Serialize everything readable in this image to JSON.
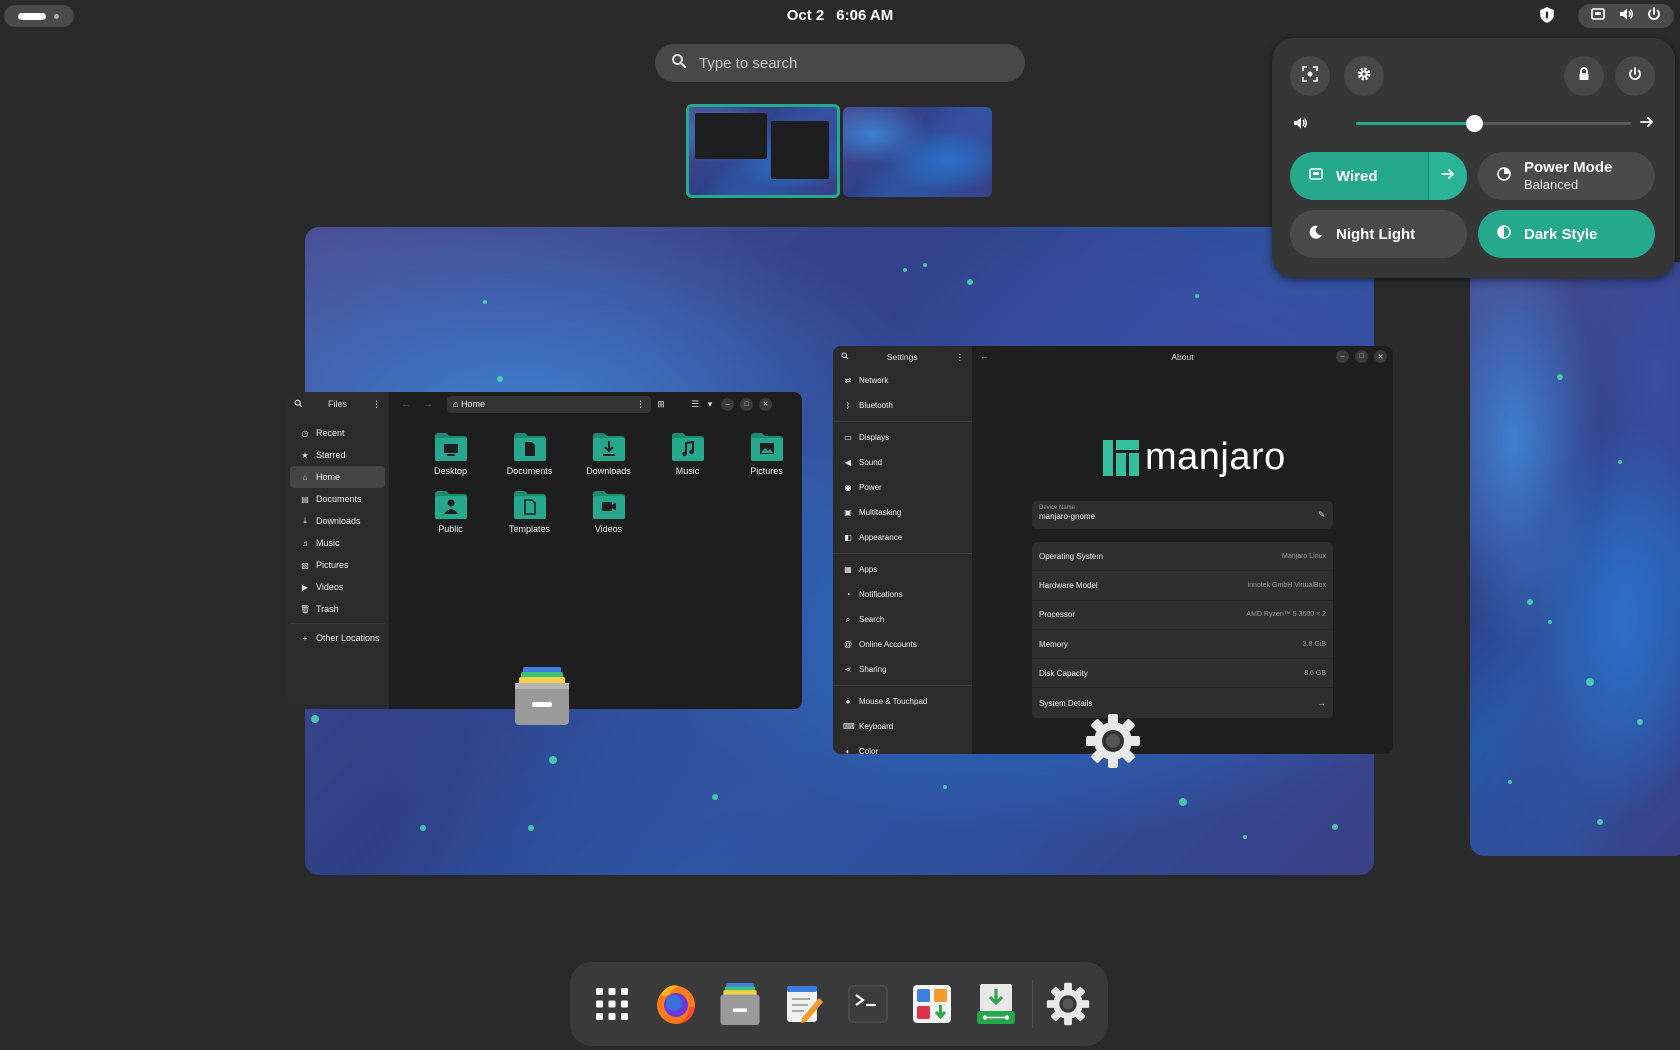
{
  "topbar": {
    "date": "Oct 2",
    "time": "6:06 AM"
  },
  "search": {
    "placeholder": "Type to search"
  },
  "files": {
    "title": "Files",
    "path": "Home",
    "sidebar": [
      {
        "icon": "clock-icon",
        "label": "Recent"
      },
      {
        "icon": "star-icon",
        "label": "Starred"
      },
      {
        "icon": "home-icon",
        "label": "Home"
      },
      {
        "icon": "document-icon",
        "label": "Documents"
      },
      {
        "icon": "download-icon",
        "label": "Downloads"
      },
      {
        "icon": "music-icon",
        "label": "Music"
      },
      {
        "icon": "picture-icon",
        "label": "Pictures"
      },
      {
        "icon": "video-icon",
        "label": "Videos"
      },
      {
        "icon": "trash-icon",
        "label": "Trash"
      },
      {
        "icon": "plus-icon",
        "label": "Other Locations"
      }
    ],
    "folders": [
      {
        "name": "Desktop",
        "icon": "desktop-folder-icon"
      },
      {
        "name": "Documents",
        "icon": "documents-folder-icon"
      },
      {
        "name": "Downloads",
        "icon": "downloads-folder-icon"
      },
      {
        "name": "Music",
        "icon": "music-folder-icon"
      },
      {
        "name": "Pictures",
        "icon": "pictures-folder-icon"
      },
      {
        "name": "Public",
        "icon": "public-folder-icon"
      },
      {
        "name": "Templates",
        "icon": "templates-folder-icon"
      },
      {
        "name": "Videos",
        "icon": "videos-folder-icon"
      }
    ]
  },
  "settings": {
    "title": "Settings",
    "page_title": "About",
    "sidebar": [
      {
        "icon": "network-icon",
        "label": "Network"
      },
      {
        "icon": "bluetooth-icon",
        "label": "Bluetooth"
      },
      {
        "icon": "display-icon",
        "label": "Displays"
      },
      {
        "icon": "sound-icon",
        "label": "Sound"
      },
      {
        "icon": "power-icon",
        "label": "Power"
      },
      {
        "icon": "multitasking-icon",
        "label": "Multitasking"
      },
      {
        "icon": "appearance-icon",
        "label": "Appearance"
      },
      {
        "icon": "apps-icon",
        "label": "Apps"
      },
      {
        "icon": "notifications-icon",
        "label": "Notifications"
      },
      {
        "icon": "search-icon",
        "label": "Search"
      },
      {
        "icon": "online-accounts-icon",
        "label": "Online Accounts"
      },
      {
        "icon": "sharing-icon",
        "label": "Sharing"
      },
      {
        "icon": "mouse-icon",
        "label": "Mouse & Touchpad"
      },
      {
        "icon": "keyboard-icon",
        "label": "Keyboard"
      },
      {
        "icon": "color-icon",
        "label": "Color"
      }
    ],
    "logo_text": "manjaro",
    "device_name_label": "Device Name",
    "device_name": "manjaro-gnome",
    "info": [
      {
        "key": "Operating System",
        "value": "Manjaro Linux"
      },
      {
        "key": "Hardware Model",
        "value": "innotek GmbH VirtualBox"
      },
      {
        "key": "Processor",
        "value": "AMD Ryzen™ 5 3600 × 2"
      },
      {
        "key": "Memory",
        "value": "3.8 GiB"
      },
      {
        "key": "Disk Capacity",
        "value": "8.6 GB"
      },
      {
        "key": "System Details",
        "value": ""
      }
    ]
  },
  "quick_settings": {
    "volume_level": 0.43,
    "wired_label": "Wired",
    "power_mode_label": "Power Mode",
    "power_mode_value": "Balanced",
    "night_light_label": "Night Light",
    "dark_style_label": "Dark Style",
    "accent_color": "#26a88c"
  },
  "dash": {
    "items": [
      "app-grid-icon",
      "firefox-icon",
      "files-icon",
      "text-editor-icon",
      "terminal-icon",
      "software-icon",
      "installer-icon",
      "settings-icon"
    ]
  }
}
